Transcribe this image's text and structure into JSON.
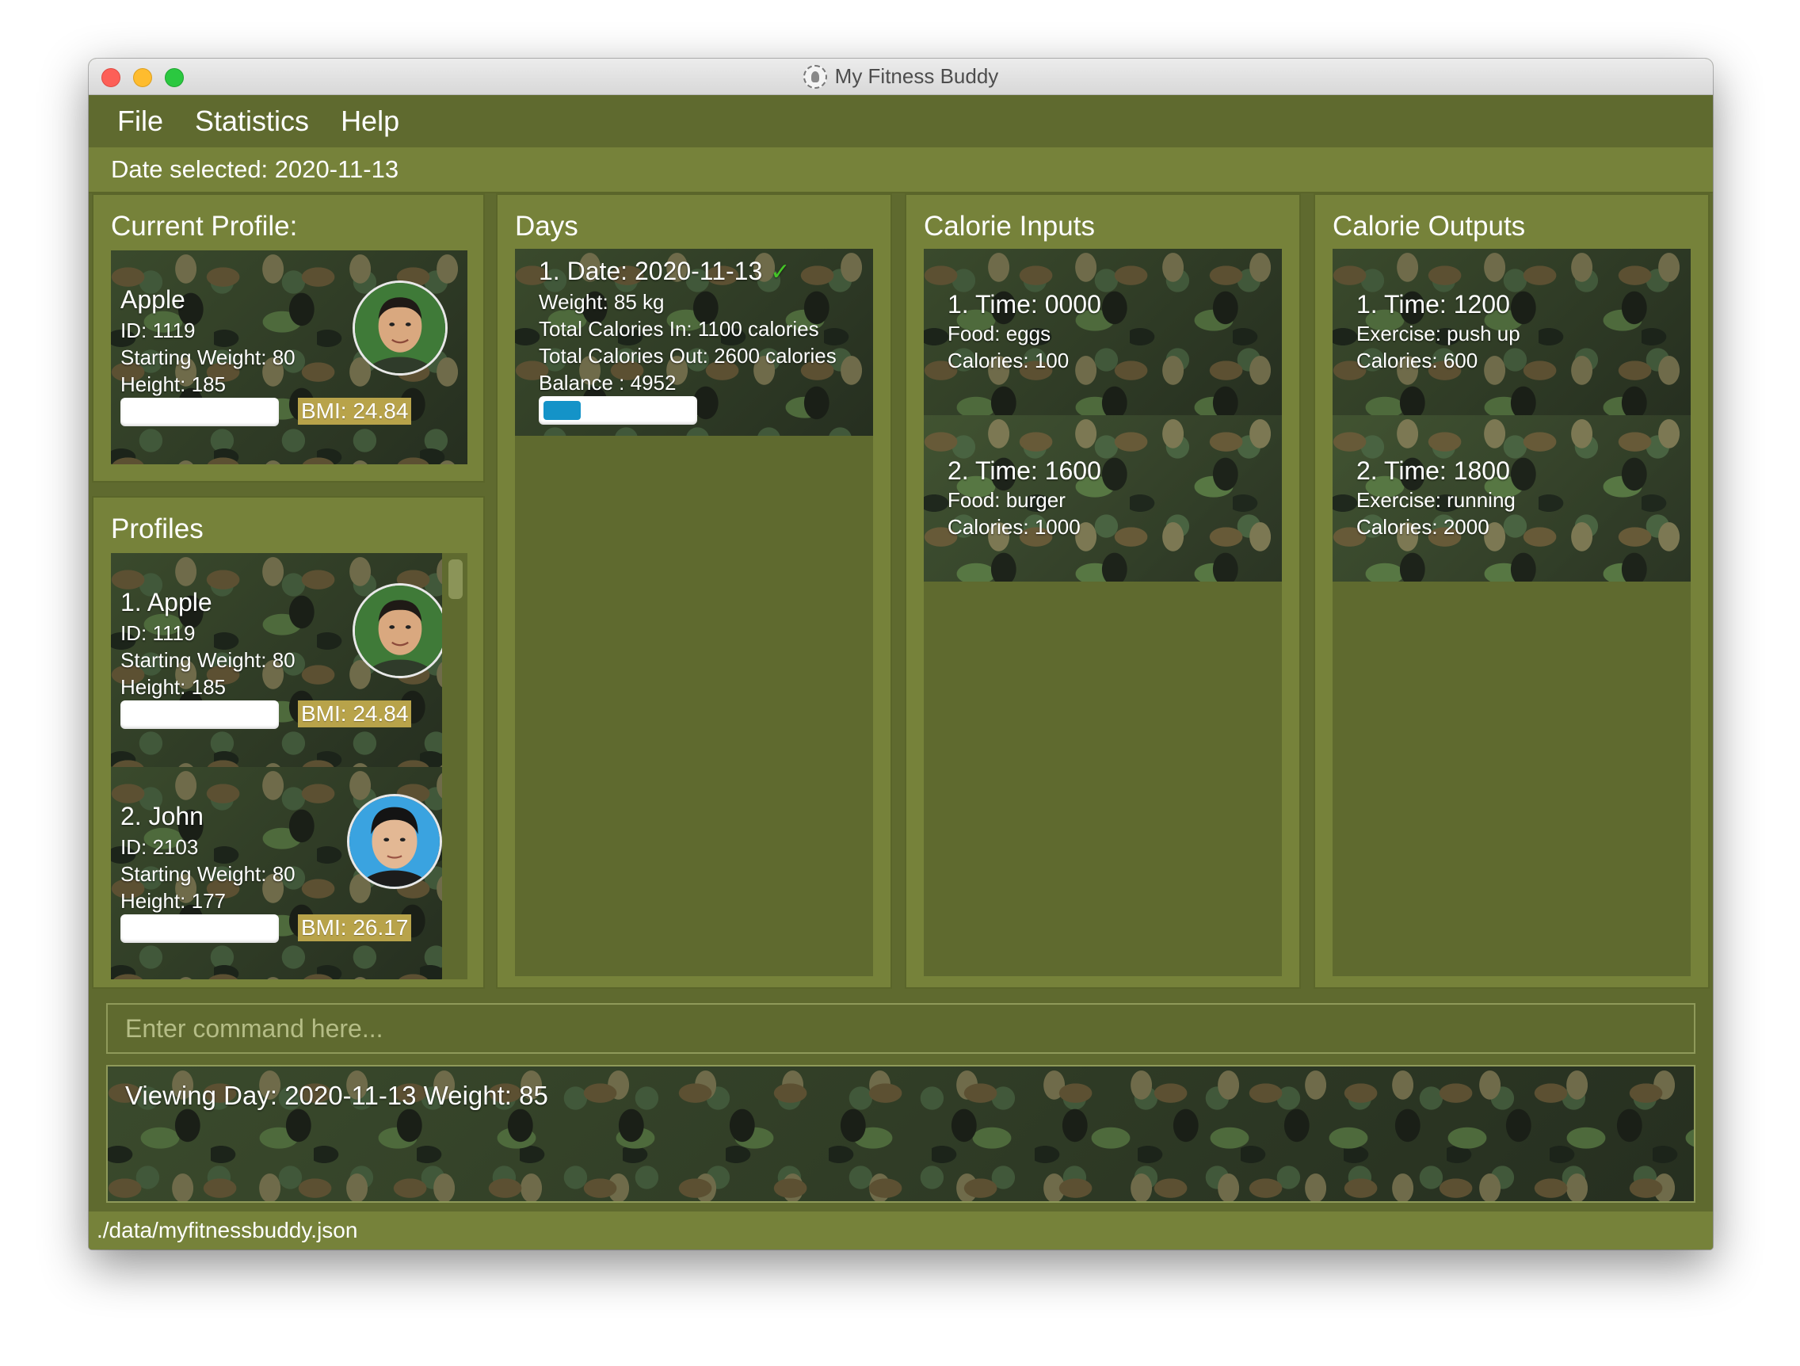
{
  "window": {
    "title": "My Fitness Buddy"
  },
  "menu": {
    "file": "File",
    "statistics": "Statistics",
    "help": "Help"
  },
  "date_bar": {
    "text": "Date selected: 2020-11-13"
  },
  "current_profile": {
    "header": "Current Profile:",
    "name": "Apple",
    "id": "ID: 1119",
    "starting_weight": "Starting Weight: 80",
    "height": "Height: 185",
    "bmi": "BMI: 24.84",
    "progress": 0
  },
  "profiles": {
    "header": "Profiles",
    "items": [
      {
        "title": "1.  Apple",
        "id": "ID: 1119",
        "starting_weight": "Starting Weight: 80",
        "height": "Height: 185",
        "bmi": "BMI: 24.84",
        "progress": 0
      },
      {
        "title": "2.  John",
        "id": "ID: 2103",
        "starting_weight": "Starting Weight: 80",
        "height": "Height: 177",
        "bmi": "BMI: 26.17",
        "progress": 0
      }
    ]
  },
  "days": {
    "header": "Days",
    "items": [
      {
        "title": "1.  Date: 2020-11-13",
        "check": "✓",
        "weight": "Weight: 85 kg",
        "calories_in": "Total Calories In: 1100 calories",
        "calories_out": "Total Calories Out: 2600 calories",
        "balance": "Balance : 4952",
        "progress": 0.25
      }
    ]
  },
  "calorie_inputs": {
    "header": "Calorie Inputs",
    "items": [
      {
        "title": "1.  Time: 0000",
        "food": "Food: eggs",
        "calories": "Calories: 100"
      },
      {
        "title": "2.  Time: 1600",
        "food": "Food: burger",
        "calories": "Calories: 1000"
      }
    ]
  },
  "calorie_outputs": {
    "header": "Calorie Outputs",
    "items": [
      {
        "title": "1.  Time: 1200",
        "exercise": "Exercise: push up",
        "calories": "Calories: 600"
      },
      {
        "title": "2.  Time: 1800",
        "exercise": "Exercise: running",
        "calories": "Calories: 2000"
      }
    ]
  },
  "command": {
    "placeholder": "Enter command here...",
    "value": ""
  },
  "result": {
    "text": "Viewing Day: 2020-11-13 Weight: 85"
  },
  "status": {
    "path": "./data/myfitnessbuddy.json"
  },
  "colors": {
    "accent": "#5f6a2f",
    "panel": "#76823a",
    "progress": "#1493c8",
    "bmi_badge": "#b8a34a",
    "check": "#45c427"
  }
}
